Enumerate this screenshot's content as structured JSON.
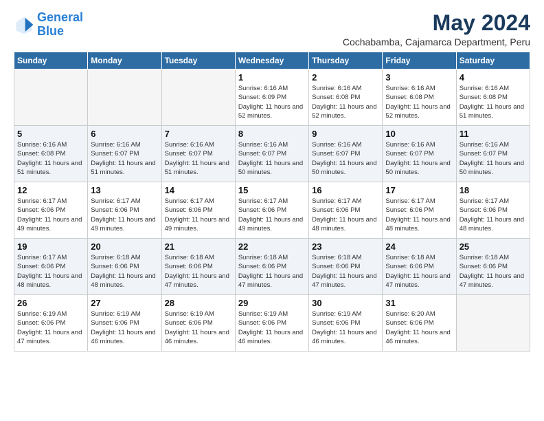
{
  "logo": {
    "line1": "General",
    "line2": "Blue"
  },
  "title": "May 2024",
  "location": "Cochabamba, Cajamarca Department, Peru",
  "days_of_week": [
    "Sunday",
    "Monday",
    "Tuesday",
    "Wednesday",
    "Thursday",
    "Friday",
    "Saturday"
  ],
  "weeks": [
    [
      {
        "day": "",
        "info": ""
      },
      {
        "day": "",
        "info": ""
      },
      {
        "day": "",
        "info": ""
      },
      {
        "day": "1",
        "info": "Sunrise: 6:16 AM\nSunset: 6:09 PM\nDaylight: 11 hours and 52 minutes."
      },
      {
        "day": "2",
        "info": "Sunrise: 6:16 AM\nSunset: 6:08 PM\nDaylight: 11 hours and 52 minutes."
      },
      {
        "day": "3",
        "info": "Sunrise: 6:16 AM\nSunset: 6:08 PM\nDaylight: 11 hours and 52 minutes."
      },
      {
        "day": "4",
        "info": "Sunrise: 6:16 AM\nSunset: 6:08 PM\nDaylight: 11 hours and 51 minutes."
      }
    ],
    [
      {
        "day": "5",
        "info": "Sunrise: 6:16 AM\nSunset: 6:08 PM\nDaylight: 11 hours and 51 minutes."
      },
      {
        "day": "6",
        "info": "Sunrise: 6:16 AM\nSunset: 6:07 PM\nDaylight: 11 hours and 51 minutes."
      },
      {
        "day": "7",
        "info": "Sunrise: 6:16 AM\nSunset: 6:07 PM\nDaylight: 11 hours and 51 minutes."
      },
      {
        "day": "8",
        "info": "Sunrise: 6:16 AM\nSunset: 6:07 PM\nDaylight: 11 hours and 50 minutes."
      },
      {
        "day": "9",
        "info": "Sunrise: 6:16 AM\nSunset: 6:07 PM\nDaylight: 11 hours and 50 minutes."
      },
      {
        "day": "10",
        "info": "Sunrise: 6:16 AM\nSunset: 6:07 PM\nDaylight: 11 hours and 50 minutes."
      },
      {
        "day": "11",
        "info": "Sunrise: 6:16 AM\nSunset: 6:07 PM\nDaylight: 11 hours and 50 minutes."
      }
    ],
    [
      {
        "day": "12",
        "info": "Sunrise: 6:17 AM\nSunset: 6:06 PM\nDaylight: 11 hours and 49 minutes."
      },
      {
        "day": "13",
        "info": "Sunrise: 6:17 AM\nSunset: 6:06 PM\nDaylight: 11 hours and 49 minutes."
      },
      {
        "day": "14",
        "info": "Sunrise: 6:17 AM\nSunset: 6:06 PM\nDaylight: 11 hours and 49 minutes."
      },
      {
        "day": "15",
        "info": "Sunrise: 6:17 AM\nSunset: 6:06 PM\nDaylight: 11 hours and 49 minutes."
      },
      {
        "day": "16",
        "info": "Sunrise: 6:17 AM\nSunset: 6:06 PM\nDaylight: 11 hours and 48 minutes."
      },
      {
        "day": "17",
        "info": "Sunrise: 6:17 AM\nSunset: 6:06 PM\nDaylight: 11 hours and 48 minutes."
      },
      {
        "day": "18",
        "info": "Sunrise: 6:17 AM\nSunset: 6:06 PM\nDaylight: 11 hours and 48 minutes."
      }
    ],
    [
      {
        "day": "19",
        "info": "Sunrise: 6:17 AM\nSunset: 6:06 PM\nDaylight: 11 hours and 48 minutes."
      },
      {
        "day": "20",
        "info": "Sunrise: 6:18 AM\nSunset: 6:06 PM\nDaylight: 11 hours and 48 minutes."
      },
      {
        "day": "21",
        "info": "Sunrise: 6:18 AM\nSunset: 6:06 PM\nDaylight: 11 hours and 47 minutes."
      },
      {
        "day": "22",
        "info": "Sunrise: 6:18 AM\nSunset: 6:06 PM\nDaylight: 11 hours and 47 minutes."
      },
      {
        "day": "23",
        "info": "Sunrise: 6:18 AM\nSunset: 6:06 PM\nDaylight: 11 hours and 47 minutes."
      },
      {
        "day": "24",
        "info": "Sunrise: 6:18 AM\nSunset: 6:06 PM\nDaylight: 11 hours and 47 minutes."
      },
      {
        "day": "25",
        "info": "Sunrise: 6:18 AM\nSunset: 6:06 PM\nDaylight: 11 hours and 47 minutes."
      }
    ],
    [
      {
        "day": "26",
        "info": "Sunrise: 6:19 AM\nSunset: 6:06 PM\nDaylight: 11 hours and 47 minutes."
      },
      {
        "day": "27",
        "info": "Sunrise: 6:19 AM\nSunset: 6:06 PM\nDaylight: 11 hours and 46 minutes."
      },
      {
        "day": "28",
        "info": "Sunrise: 6:19 AM\nSunset: 6:06 PM\nDaylight: 11 hours and 46 minutes."
      },
      {
        "day": "29",
        "info": "Sunrise: 6:19 AM\nSunset: 6:06 PM\nDaylight: 11 hours and 46 minutes."
      },
      {
        "day": "30",
        "info": "Sunrise: 6:19 AM\nSunset: 6:06 PM\nDaylight: 11 hours and 46 minutes."
      },
      {
        "day": "31",
        "info": "Sunrise: 6:20 AM\nSunset: 6:06 PM\nDaylight: 11 hours and 46 minutes."
      },
      {
        "day": "",
        "info": ""
      }
    ]
  ]
}
